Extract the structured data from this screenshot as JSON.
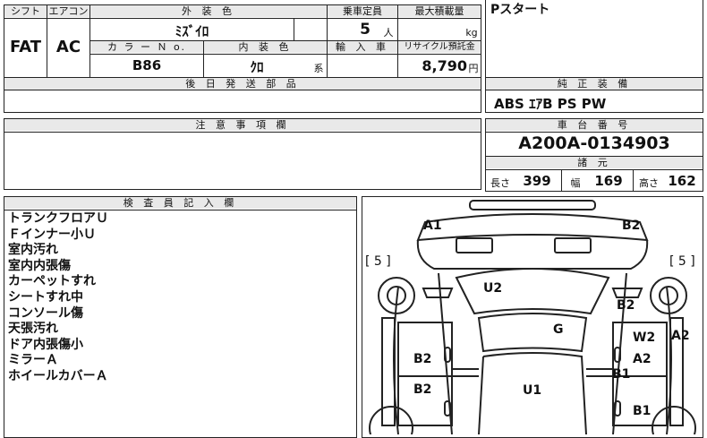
{
  "header": {
    "shift_label": "シフト",
    "aircon_label": "エアコン",
    "ext_color_label": "外 装 色",
    "capacity_label": "乗車定員",
    "max_load_label": "最大積載量",
    "color_no_label": "カ ラ ー Ｎ o.",
    "int_color_label": "内 装 色",
    "import_label": "輸 入 車",
    "recycle_label": "リサイクル預託金",
    "delivery_parts_label": "後 日 発 送 部 品"
  },
  "values": {
    "shift": "FAT",
    "aircon": "AC",
    "ext_color": "ﾐｽﾞｲﾛ",
    "capacity": "5",
    "capacity_unit": "人",
    "max_load_unit": "kg",
    "color_no": "B86",
    "int_color": "ｸﾛ",
    "int_color_suffix": "系",
    "recycle": "8,790",
    "recycle_unit": "円"
  },
  "right_top": {
    "note": "Pスタート"
  },
  "equipment": {
    "label": "純 正 装 備",
    "value": "ABS ｴｱB PS PW"
  },
  "caution": {
    "label": "注 意 事 項 欄"
  },
  "chassis": {
    "label": "車 台 番 号",
    "value": "A200A-0134903",
    "specs_label": "諸 元",
    "length_label": "長さ",
    "length": "399",
    "width_label": "幅",
    "width": "169",
    "height_label": "高さ",
    "height": "162"
  },
  "inspector": {
    "label": "検 査 員 記 入 欄",
    "notes": [
      "トランクフロアＵ",
      "Ｆインナー小Ｕ",
      "室内汚れ",
      "室内内張傷",
      "カーペットすれ",
      "シートすれ中",
      "コンソール傷",
      "天張汚れ",
      "ドア内張傷小",
      "ミラーＡ",
      "ホイールカバーＡ"
    ]
  },
  "diagram": {
    "tire_left": "[ 5 ]",
    "tire_right": "[ 5 ]",
    "marks": {
      "a1": "A1",
      "b2_top": "B2",
      "a2_right": "A2",
      "u2": "U2",
      "b2_mid": "B2",
      "g": "G",
      "w2": "W2",
      "a2_door": "A2",
      "b1_door": "B1",
      "b2_left1": "B2",
      "b2_left2": "B2",
      "u1": "U1",
      "b1_bottom": "B1"
    }
  }
}
